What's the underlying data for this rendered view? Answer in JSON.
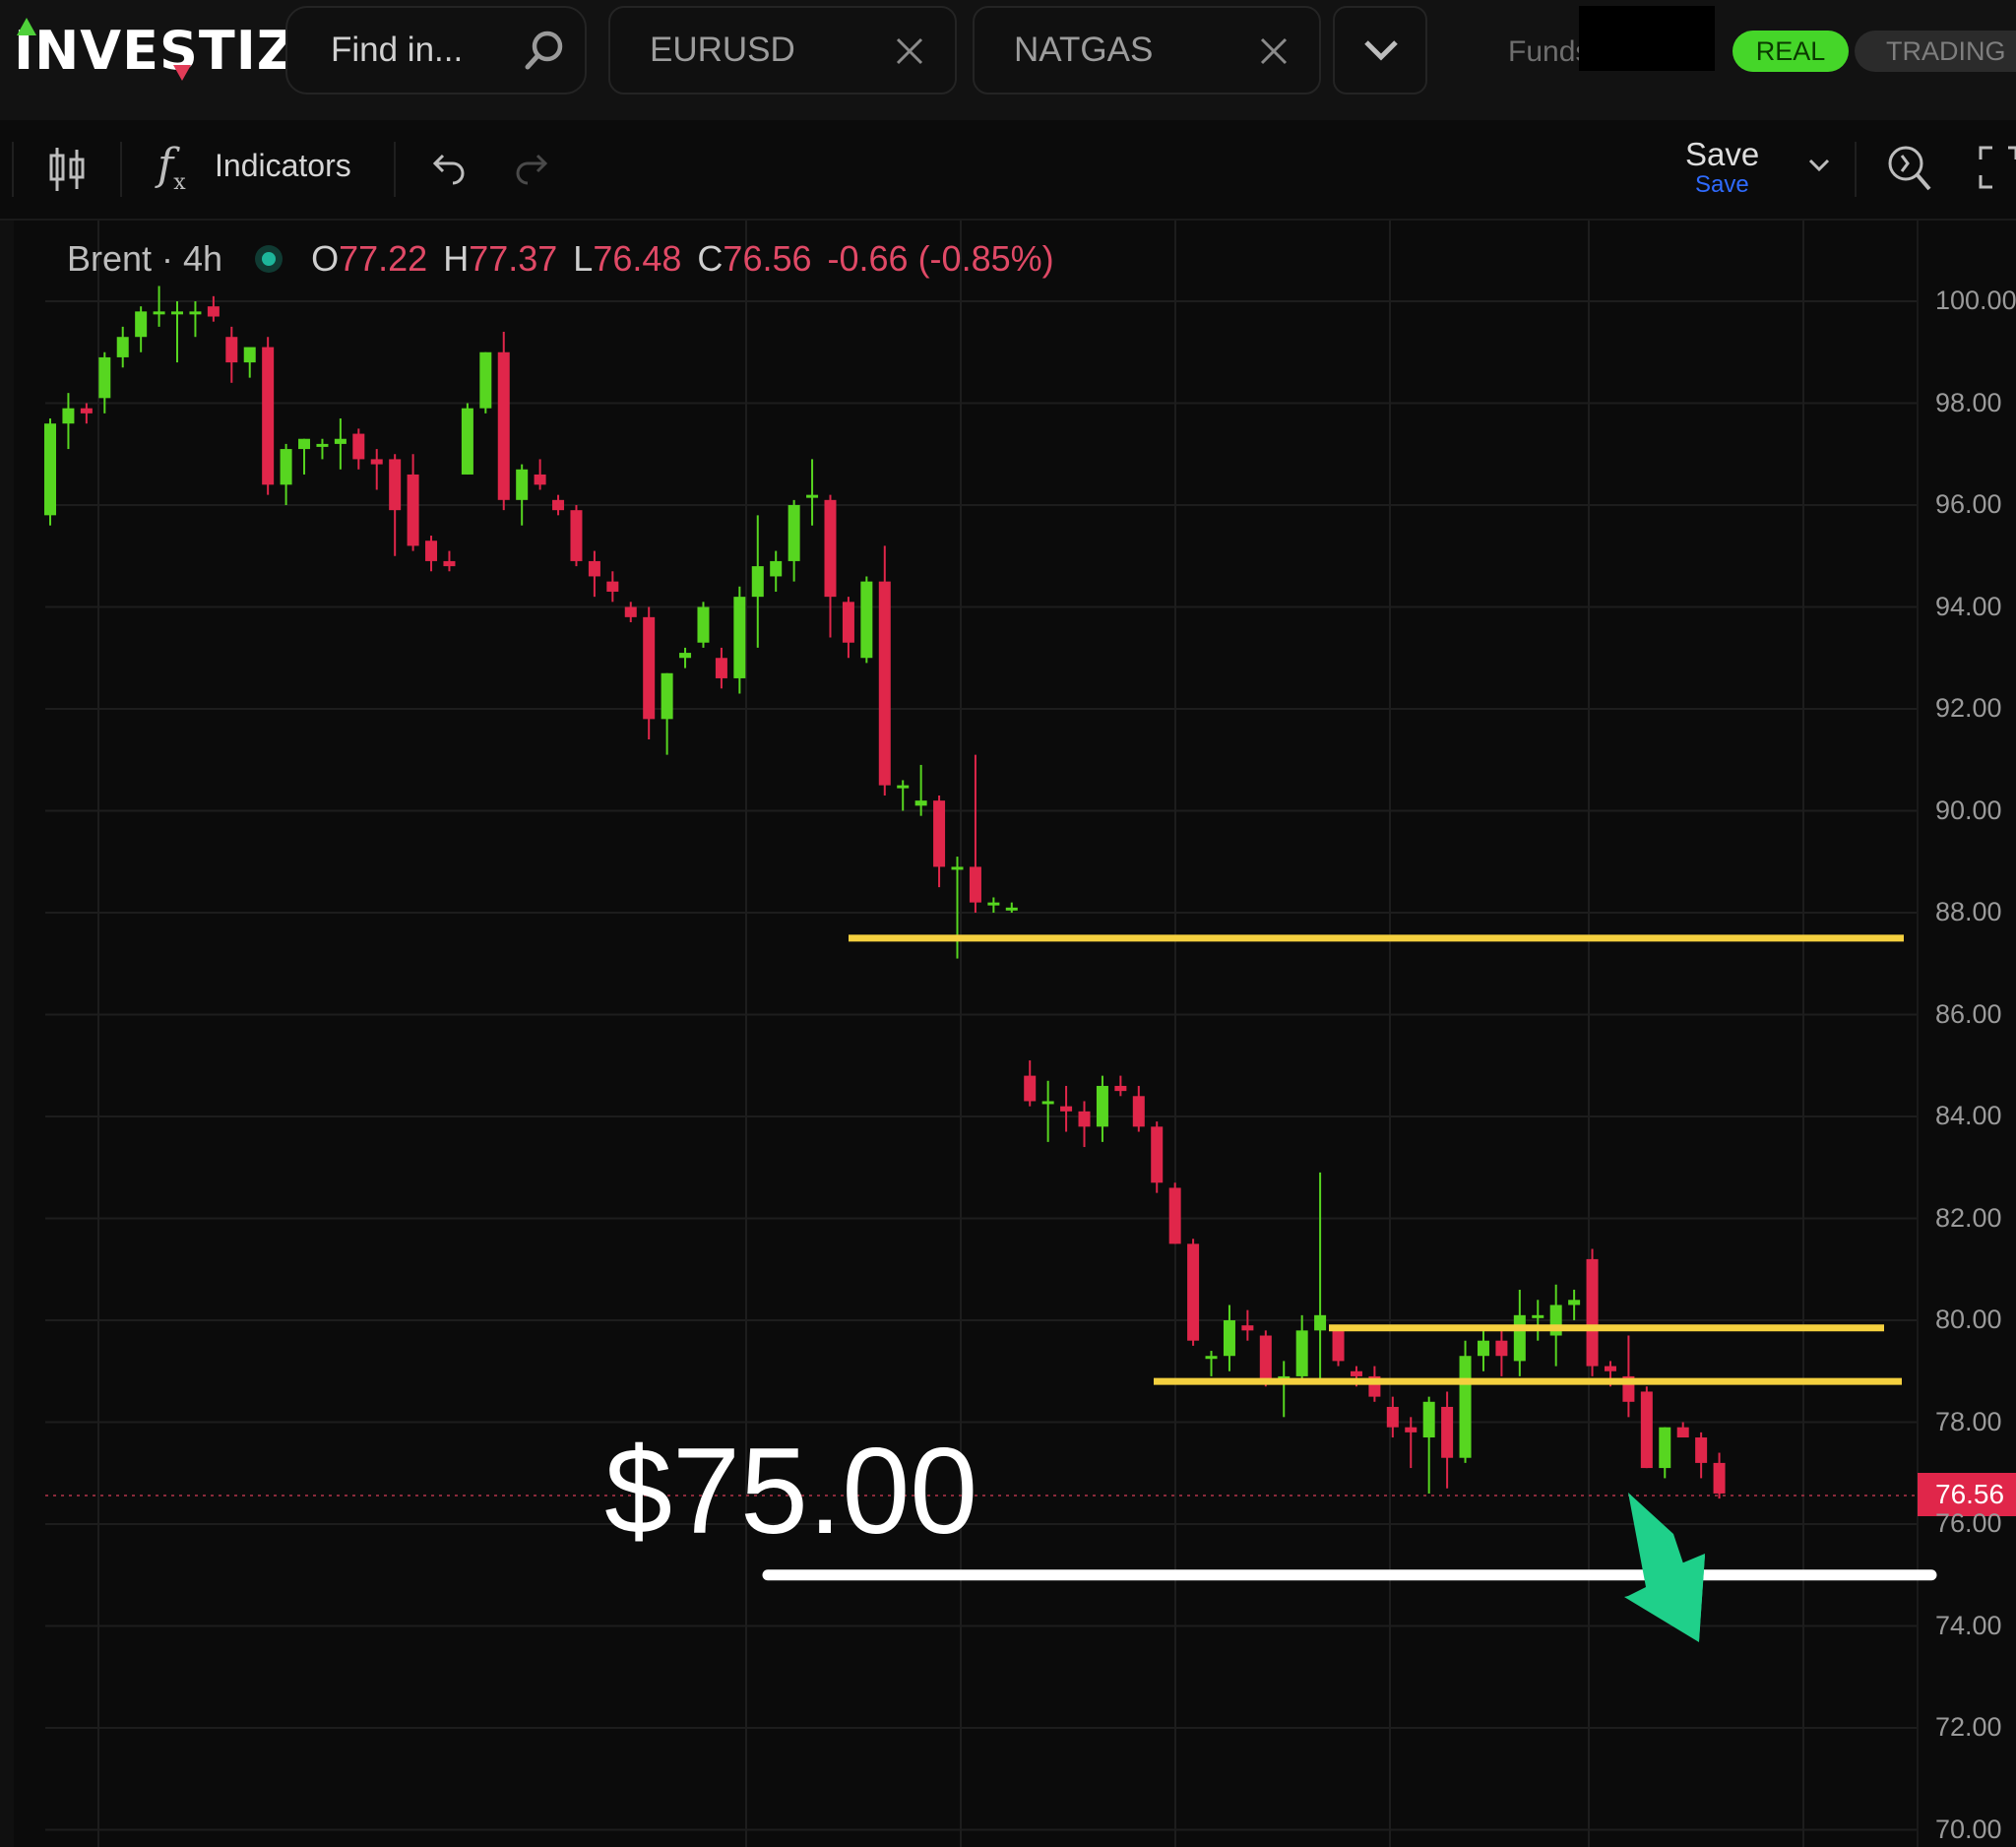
{
  "header": {
    "logo_text": "INVESTIZO",
    "search_placeholder": "Find in...",
    "tabs": [
      {
        "label": "EURUSD"
      },
      {
        "label": "NATGAS"
      }
    ],
    "funds_label": "Funds",
    "real_label": "REAL",
    "trading_label": "TRADING"
  },
  "toolbar": {
    "indicators_label": "Indicators",
    "save_label": "Save",
    "save_sublabel": "Save"
  },
  "legend": {
    "symbol": "Brent · 4h",
    "open_key": "O",
    "open": "77.22",
    "high_key": "H",
    "high": "77.37",
    "low_key": "L",
    "low": "76.48",
    "close_key": "C",
    "close": "76.56",
    "change": "-0.66 (-0.85%)"
  },
  "annotation": {
    "price_text": "$75.00",
    "level": 75.0
  },
  "colors": {
    "up": "#57d620",
    "down": "#e0264a",
    "level_line": "#f4d03f",
    "target_line": "#ffffff",
    "arrow": "#1fd08a"
  },
  "chart_data": {
    "type": "candlestick",
    "ylim": [
      70,
      100
    ],
    "yticks": [
      "100.00",
      "98.00",
      "96.00",
      "94.00",
      "92.00",
      "90.00",
      "88.00",
      "86.00",
      "84.00",
      "82.00",
      "80.00",
      "78.00",
      "76.00",
      "74.00",
      "72.00",
      "70.00"
    ],
    "last_price": "76.56",
    "horizontal_levels": [
      {
        "price": 87.5,
        "color": "yellow"
      },
      {
        "price": 79.85,
        "color": "yellow"
      },
      {
        "price": 78.8,
        "color": "yellow"
      },
      {
        "price": 75.0,
        "color": "white"
      }
    ],
    "candles": [
      [
        95.8,
        97.7,
        95.6,
        97.6
      ],
      [
        97.6,
        98.2,
        97.1,
        97.9
      ],
      [
        97.9,
        98.0,
        97.6,
        97.8
      ],
      [
        98.1,
        99.0,
        97.8,
        98.9
      ],
      [
        98.9,
        99.5,
        98.7,
        99.3
      ],
      [
        99.3,
        99.9,
        99.0,
        99.8
      ],
      [
        99.8,
        100.3,
        99.5,
        99.8
      ],
      [
        99.8,
        100.0,
        98.8,
        99.8
      ],
      [
        99.8,
        100.0,
        99.3,
        99.8
      ],
      [
        99.9,
        100.1,
        99.6,
        99.7
      ],
      [
        99.3,
        99.5,
        98.4,
        98.8
      ],
      [
        98.8,
        99.0,
        98.5,
        99.1
      ],
      [
        99.1,
        99.3,
        96.2,
        96.4
      ],
      [
        96.4,
        97.2,
        96.0,
        97.1
      ],
      [
        97.1,
        97.3,
        96.6,
        97.3
      ],
      [
        97.2,
        97.3,
        96.9,
        97.2
      ],
      [
        97.2,
        97.7,
        96.7,
        97.3
      ],
      [
        97.4,
        97.5,
        96.7,
        96.9
      ],
      [
        96.9,
        97.1,
        96.3,
        96.8
      ],
      [
        96.9,
        97.0,
        95.0,
        95.9
      ],
      [
        96.6,
        97.0,
        95.1,
        95.2
      ],
      [
        95.3,
        95.4,
        94.7,
        94.9
      ],
      [
        94.9,
        95.1,
        94.7,
        94.8
      ],
      [
        96.6,
        98.0,
        96.6,
        97.9
      ],
      [
        97.9,
        99.0,
        97.8,
        99.0
      ],
      [
        99.0,
        99.4,
        95.9,
        96.1
      ],
      [
        96.1,
        96.8,
        95.6,
        96.7
      ],
      [
        96.6,
        96.9,
        96.3,
        96.4
      ],
      [
        96.1,
        96.2,
        95.8,
        95.9
      ],
      [
        95.9,
        96.0,
        94.8,
        94.9
      ],
      [
        94.9,
        95.1,
        94.2,
        94.6
      ],
      [
        94.5,
        94.7,
        94.1,
        94.3
      ],
      [
        94.0,
        94.1,
        93.7,
        93.8
      ],
      [
        93.8,
        94.0,
        91.4,
        91.8
      ],
      [
        91.8,
        92.7,
        91.1,
        92.7
      ],
      [
        93.0,
        93.2,
        92.8,
        93.1
      ],
      [
        93.3,
        94.1,
        93.2,
        94.0
      ],
      [
        93.0,
        93.2,
        92.4,
        92.6
      ],
      [
        92.6,
        94.4,
        92.3,
        94.2
      ],
      [
        94.2,
        95.8,
        93.2,
        94.8
      ],
      [
        94.6,
        95.1,
        94.3,
        94.9
      ],
      [
        94.9,
        96.1,
        94.5,
        96.0
      ],
      [
        96.2,
        96.9,
        95.6,
        96.2
      ],
      [
        96.1,
        96.2,
        93.4,
        94.2
      ],
      [
        94.1,
        94.2,
        93.0,
        93.3
      ],
      [
        93.0,
        94.6,
        92.9,
        94.5
      ],
      [
        94.5,
        95.2,
        90.3,
        90.5
      ],
      [
        90.5,
        90.6,
        90.0,
        90.5
      ],
      [
        90.1,
        90.9,
        89.9,
        90.2
      ],
      [
        90.2,
        90.3,
        88.5,
        88.9
      ],
      [
        88.9,
        89.1,
        87.1,
        88.9
      ],
      [
        88.9,
        91.1,
        88.0,
        88.2
      ],
      [
        88.2,
        88.3,
        88.0,
        88.2
      ],
      [
        88.1,
        88.2,
        88.0,
        88.1
      ],
      [
        84.8,
        85.1,
        84.2,
        84.3
      ],
      [
        84.3,
        84.7,
        83.5,
        84.3
      ],
      [
        84.2,
        84.6,
        83.7,
        84.1
      ],
      [
        84.1,
        84.3,
        83.4,
        83.8
      ],
      [
        83.8,
        84.8,
        83.5,
        84.6
      ],
      [
        84.6,
        84.8,
        84.4,
        84.5
      ],
      [
        84.4,
        84.6,
        83.7,
        83.8
      ],
      [
        83.8,
        83.9,
        82.5,
        82.7
      ],
      [
        82.6,
        82.7,
        81.5,
        81.5
      ],
      [
        81.5,
        81.6,
        79.5,
        79.6
      ],
      [
        79.3,
        79.4,
        78.9,
        79.3
      ],
      [
        79.3,
        80.3,
        79.0,
        80.0
      ],
      [
        79.9,
        80.2,
        79.6,
        79.8
      ],
      [
        79.7,
        79.8,
        78.7,
        78.8
      ],
      [
        78.8,
        79.2,
        78.1,
        78.9
      ],
      [
        78.9,
        80.1,
        78.8,
        79.8
      ],
      [
        79.8,
        82.9,
        78.8,
        80.1
      ],
      [
        79.8,
        79.9,
        79.1,
        79.2
      ],
      [
        79.0,
        79.1,
        78.7,
        78.9
      ],
      [
        78.9,
        79.1,
        78.4,
        78.5
      ],
      [
        78.3,
        78.5,
        77.7,
        77.9
      ],
      [
        77.9,
        78.1,
        77.1,
        77.8
      ],
      [
        77.7,
        78.5,
        76.6,
        78.4
      ],
      [
        78.3,
        78.6,
        76.7,
        77.3
      ],
      [
        77.3,
        79.6,
        77.2,
        79.3
      ],
      [
        79.3,
        79.9,
        79.0,
        79.6
      ],
      [
        79.6,
        79.9,
        78.9,
        79.3
      ],
      [
        79.2,
        80.6,
        78.9,
        80.1
      ],
      [
        80.1,
        80.4,
        79.6,
        80.1
      ],
      [
        79.7,
        80.7,
        79.1,
        80.3
      ],
      [
        80.3,
        80.6,
        80.0,
        80.4
      ],
      [
        81.2,
        81.4,
        78.9,
        79.1
      ],
      [
        79.1,
        79.2,
        78.7,
        79.0
      ],
      [
        78.9,
        79.7,
        78.1,
        78.4
      ],
      [
        78.6,
        78.7,
        77.1,
        77.1
      ],
      [
        77.1,
        77.9,
        76.9,
        77.9
      ],
      [
        77.9,
        78.0,
        77.8,
        77.7
      ],
      [
        77.7,
        77.8,
        76.9,
        77.2
      ],
      [
        77.2,
        77.4,
        76.5,
        76.6
      ]
    ]
  }
}
